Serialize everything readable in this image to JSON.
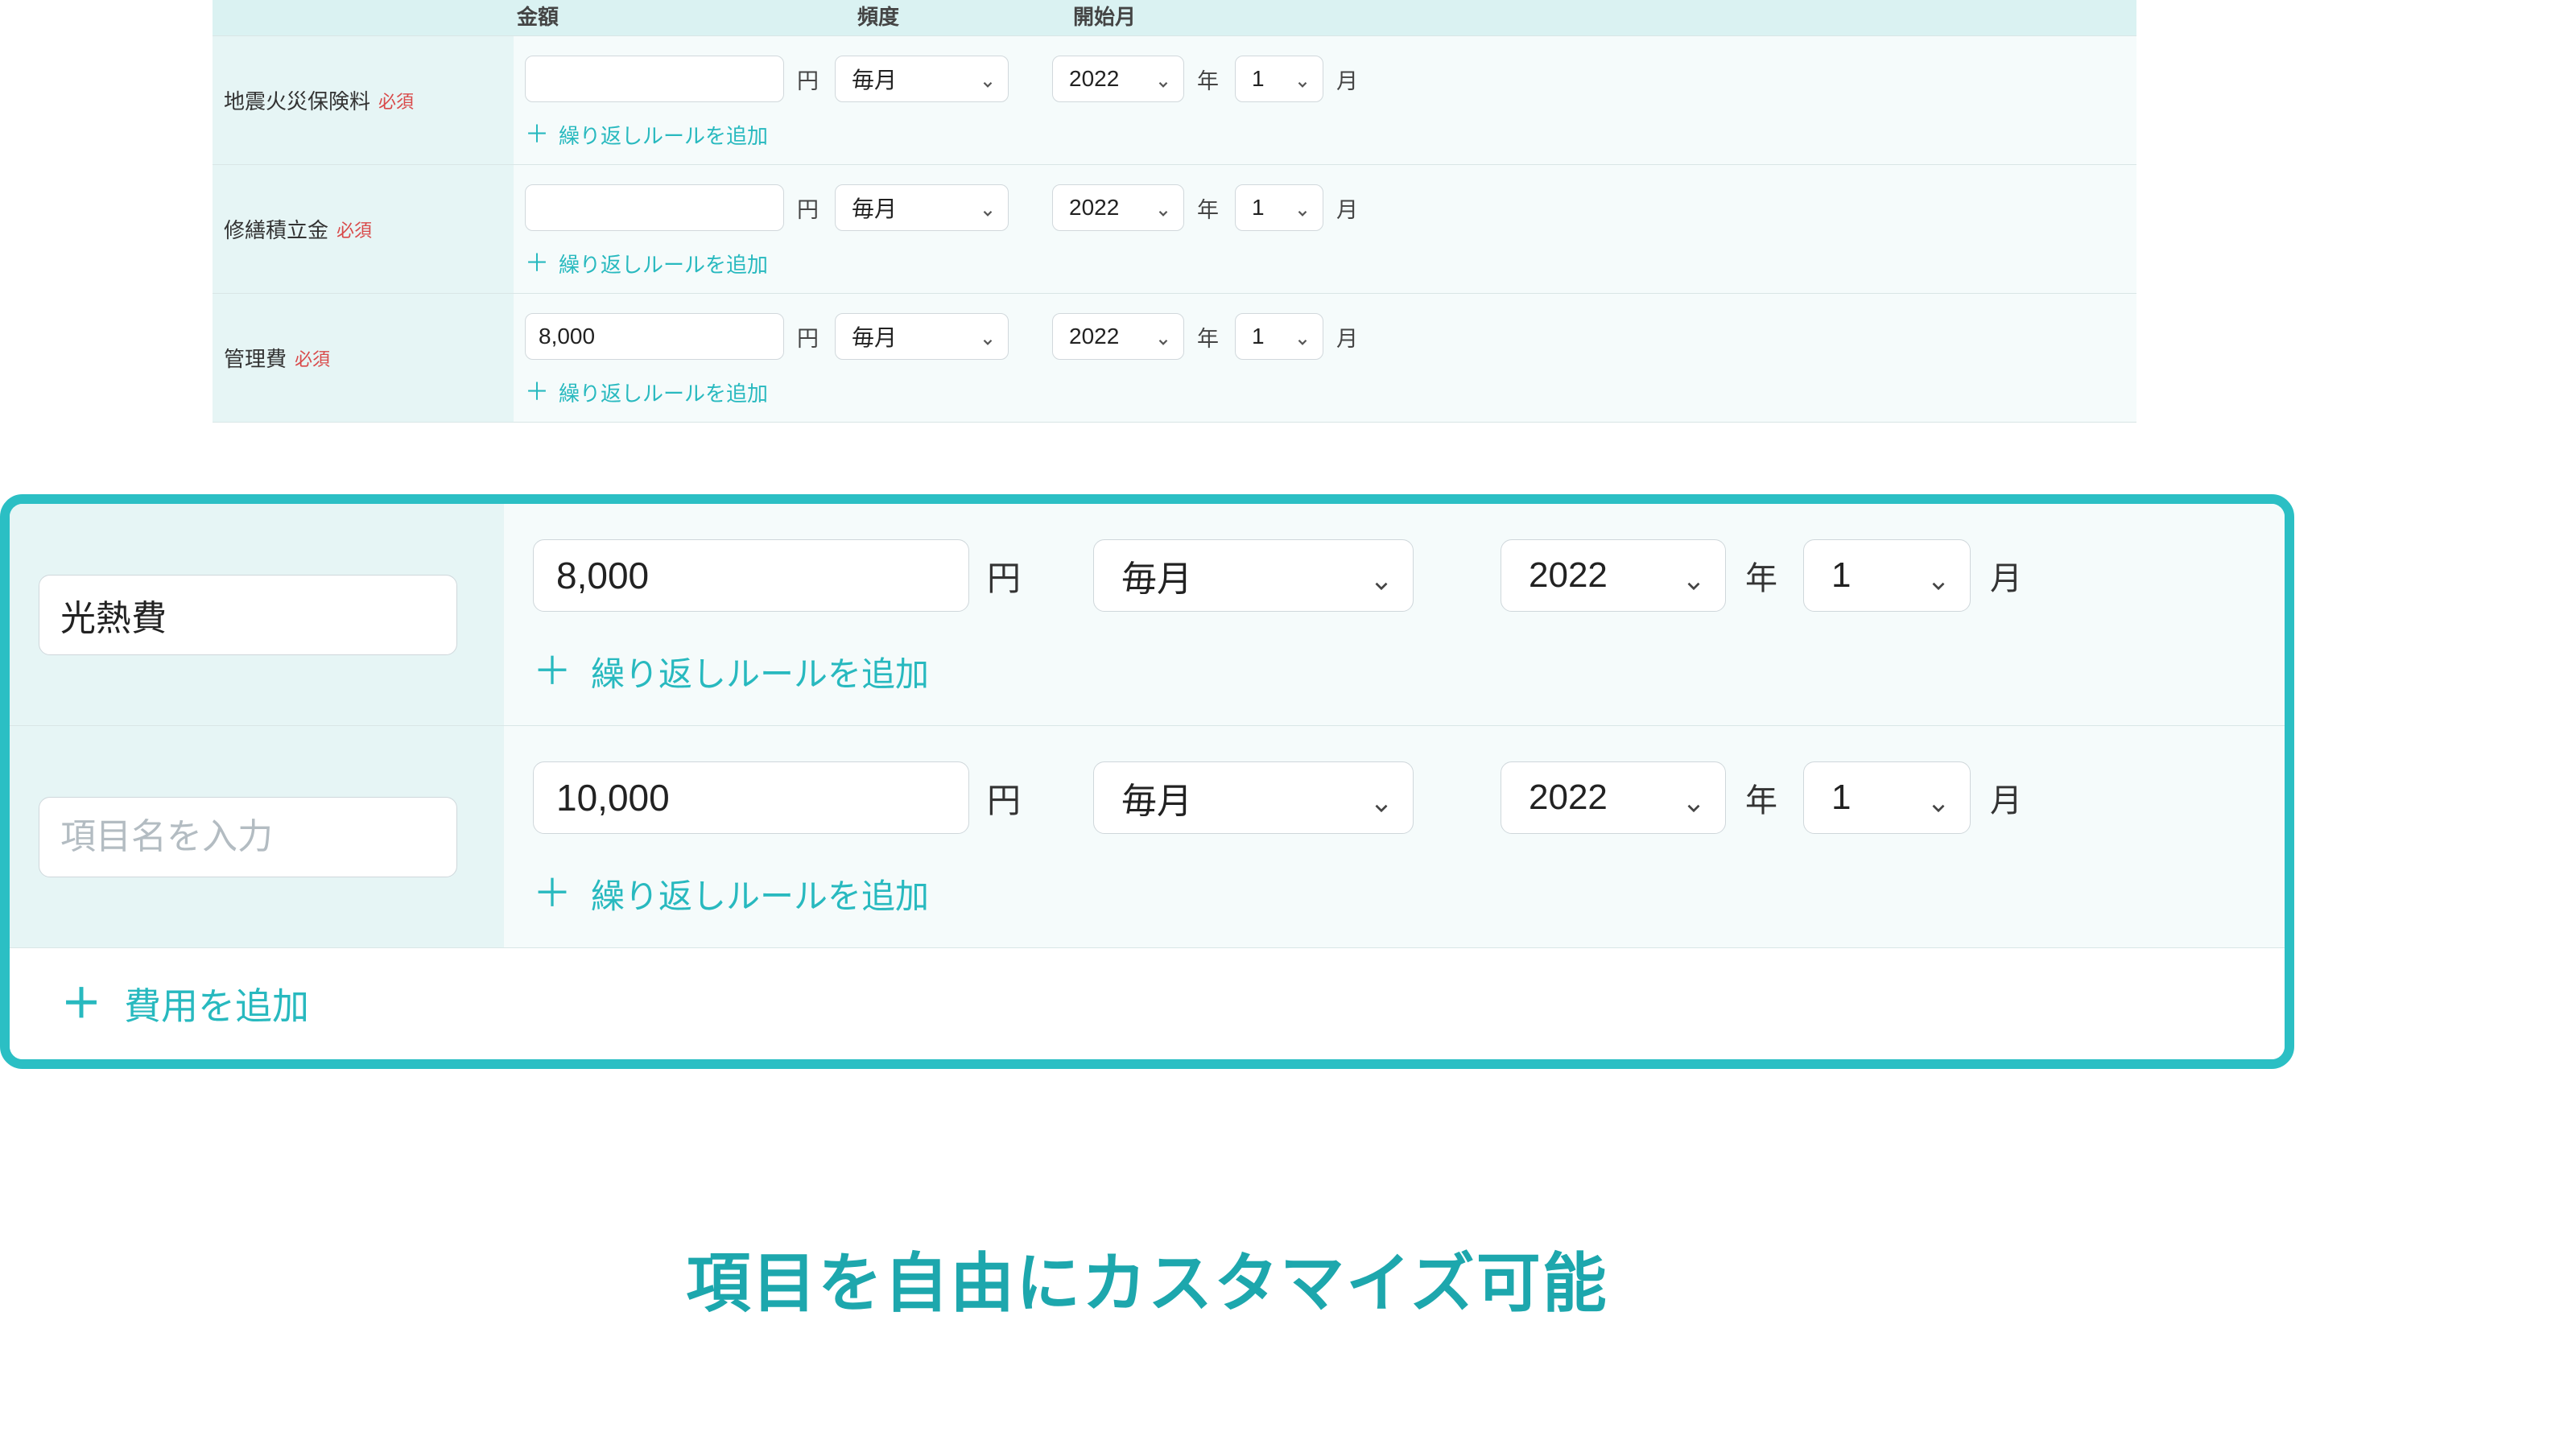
{
  "headers": {
    "amount": "金額",
    "frequency": "頻度",
    "start_month": "開始月"
  },
  "units": {
    "yen": "円",
    "year": "年",
    "month": "月"
  },
  "required_label": "必須",
  "add_rule_label": "繰り返しルールを追加",
  "add_expense_label": "費用を追加",
  "caption": "項目を自由にカスタマイズ可能",
  "rows_small": [
    {
      "label": "地震火災保険料",
      "amount": "",
      "frequency": "毎月",
      "year": "2022",
      "month": "1"
    },
    {
      "label": "修繕積立金",
      "amount": "",
      "frequency": "毎月",
      "year": "2022",
      "month": "1"
    },
    {
      "label": "管理費",
      "amount": "8,000",
      "frequency": "毎月",
      "year": "2022",
      "month": "1"
    }
  ],
  "rows_large": [
    {
      "name": "光熱費",
      "name_placeholder": "",
      "amount": "8,000",
      "frequency": "毎月",
      "year": "2022",
      "month": "1"
    },
    {
      "name": "",
      "name_placeholder": "項目名を入力",
      "amount": "10,000",
      "frequency": "毎月",
      "year": "2022",
      "month": "1"
    }
  ]
}
